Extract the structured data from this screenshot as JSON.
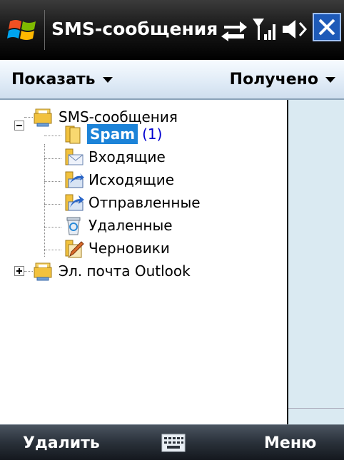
{
  "titlebar": {
    "title": "SMS-сообщения"
  },
  "header": {
    "show_label": "Показать",
    "sort_label": "Получено"
  },
  "tree": {
    "root": {
      "label": "SMS-сообщения"
    },
    "children": [
      {
        "label": "Spam",
        "count": "(1)"
      },
      {
        "label": "Входящие"
      },
      {
        "label": "Исходящие"
      },
      {
        "label": "Отправленные"
      },
      {
        "label": "Удаленные"
      },
      {
        "label": "Черновики"
      }
    ],
    "outlook": {
      "label": "Эл. почта Outlook"
    }
  },
  "softkeys": {
    "left_label": "Удалить",
    "right_label": "Меню"
  },
  "colors": {
    "selection": "#1c83d8",
    "count": "#0000d0",
    "side_pane": "#daeaf2"
  }
}
